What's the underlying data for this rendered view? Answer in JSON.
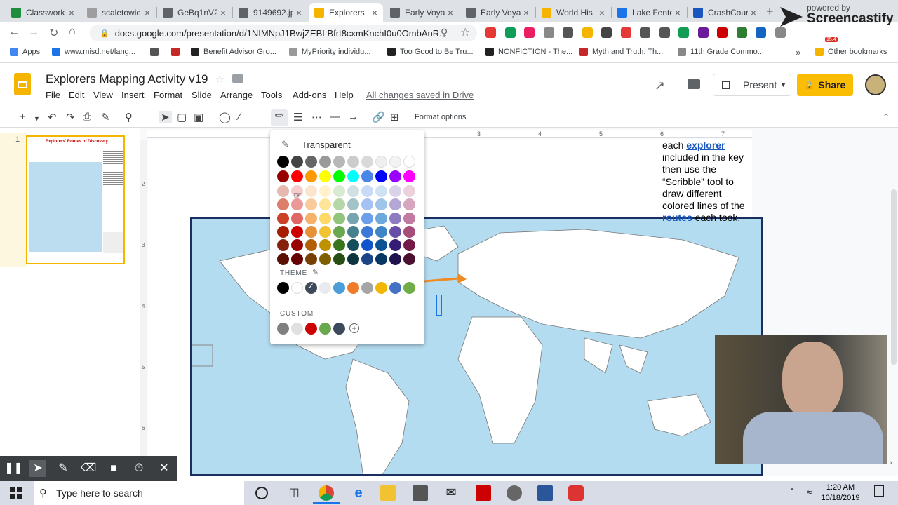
{
  "browser": {
    "tabs": [
      {
        "title": "Classwork",
        "icon": "classroom-icon",
        "color": "#1e8e3e"
      },
      {
        "title": "scaletowic",
        "icon": "image-icon",
        "color": "#9e9e9e"
      },
      {
        "title": "GeBq1nV2",
        "icon": "globe-icon",
        "color": "#5f6368"
      },
      {
        "title": "9149692.jp",
        "icon": "globe-icon",
        "color": "#5f6368"
      },
      {
        "title": "Explorers",
        "icon": "slides-icon",
        "color": "#f4b400",
        "active": true
      },
      {
        "title": "Early Voya",
        "icon": "globe-icon",
        "color": "#5f6368"
      },
      {
        "title": "Early Voya",
        "icon": "globe-icon",
        "color": "#5f6368"
      },
      {
        "title": "World His",
        "icon": "slides-icon",
        "color": "#f4b400"
      },
      {
        "title": "Lake Fento",
        "icon": "calendar-icon",
        "color": "#1a73e8"
      },
      {
        "title": "CrashCour",
        "icon": "bookmark-icon",
        "color": "#1a56c0"
      }
    ],
    "url": "docs.google.com/presentation/d/1NIMNpJ1BwjZEBLBfrt8cxmKnchI0u0OmbAnR...",
    "bookmarks": [
      {
        "label": "Apps"
      },
      {
        "label": "www.misd.net/lang..."
      },
      {
        "label": ""
      },
      {
        "label": ""
      },
      {
        "label": "Benefit Advisor Gro..."
      },
      {
        "label": "MyPriority individu..."
      },
      {
        "label": "Too Good to Be Tru..."
      },
      {
        "label": "NONFICTION - The..."
      },
      {
        "label": "Myth and Truth: Th..."
      },
      {
        "label": "11th Grade Commo..."
      },
      {
        "label": "Other bookmarks"
      }
    ],
    "extension_badge": "15.4"
  },
  "watermark": {
    "line1": "powered by",
    "line2": "Screencastify"
  },
  "docs": {
    "title": "Explorers Mapping Activity v19",
    "menus": [
      "File",
      "Edit",
      "View",
      "Insert",
      "Format",
      "Slide",
      "Arrange",
      "Tools",
      "Add-ons",
      "Help"
    ],
    "save_status": "All changes saved in Drive",
    "present_label": "Present",
    "share_label": "Share",
    "format_options": "Format options"
  },
  "filmstrip": {
    "slide_number": "1",
    "thumb_title": "Explorers' Routes of Discovery"
  },
  "ruler": [
    "3",
    "4",
    "5",
    "6",
    "7"
  ],
  "vruler": [
    "2",
    "3",
    "4",
    "5",
    "6"
  ],
  "slide": {
    "text_before_1": "each ",
    "link_1": "explorer",
    "text_middle": " included in the key then use the “Scribble” tool to draw different colored lines of the ",
    "link_2": "routes ",
    "text_after": "each took."
  },
  "picker": {
    "transparent_label": "Transparent",
    "theme_label": "THEME",
    "custom_label": "CUSTOM",
    "grid_colors": [
      [
        "#000000",
        "#434343",
        "#666666",
        "#999999",
        "#b7b7b7",
        "#cccccc",
        "#d9d9d9",
        "#efefef",
        "#f3f3f3",
        "#ffffff"
      ],
      [
        "#980000",
        "#ff0000",
        "#ff9900",
        "#ffff00",
        "#00ff00",
        "#00ffff",
        "#4a86e8",
        "#0000ff",
        "#9900ff",
        "#ff00ff"
      ],
      [
        "#e6b8af",
        "#f4cccc",
        "#fce5cd",
        "#fff2cc",
        "#d9ead3",
        "#d0e0e3",
        "#c9daf8",
        "#cfe2f3",
        "#d9d2e9",
        "#ead1dc"
      ],
      [
        "#dd7e6b",
        "#ea9999",
        "#f9cb9c",
        "#ffe599",
        "#b6d7a8",
        "#a2c4c9",
        "#a4c2f4",
        "#9fc5e8",
        "#b4a7d6",
        "#d5a6bd"
      ],
      [
        "#cc4125",
        "#e06666",
        "#f6b26b",
        "#ffd966",
        "#93c47d",
        "#76a5af",
        "#6d9eeb",
        "#6fa8dc",
        "#8e7cc3",
        "#c27ba0"
      ],
      [
        "#a61c00",
        "#cc0000",
        "#e69138",
        "#f1c232",
        "#6aa84f",
        "#45818e",
        "#3c78d8",
        "#3d85c6",
        "#674ea7",
        "#a64d79"
      ],
      [
        "#85200c",
        "#990000",
        "#b45f06",
        "#bf9000",
        "#38761d",
        "#134f5c",
        "#1155cc",
        "#0b5394",
        "#351c75",
        "#741b47"
      ],
      [
        "#5b0f00",
        "#660000",
        "#783f04",
        "#7f6000",
        "#274e13",
        "#0c343d",
        "#1c4587",
        "#073763",
        "#20124d",
        "#4c1130"
      ]
    ],
    "theme_colors": [
      "#000000",
      "#ffffff",
      "#3c4a5c",
      "#e8eaed",
      "#4a9ed9",
      "#f07c2a",
      "#a5a5a5",
      "#f2b705",
      "#4472c4",
      "#70ad47"
    ],
    "custom_colors": [
      "#808080",
      "#e0e0e0",
      "#cc0000",
      "#6aa84f",
      "#3c4a5c"
    ]
  },
  "taskbar": {
    "search_placeholder": "Type here to search",
    "time": "1:20 AM",
    "date": "10/18/2019"
  }
}
